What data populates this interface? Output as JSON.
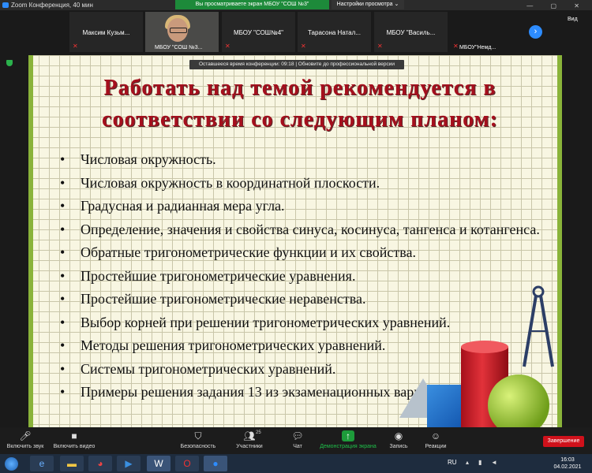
{
  "window": {
    "title": "Zoom Конференция, 40 мин",
    "controls": "— ▢ ✕"
  },
  "share_banner": "Вы просматриваете экран МБОУ \"СОШ №3\"",
  "view_options": "Настройки просмотра ⌄",
  "view_label": "Вид",
  "participants": [
    {
      "name": "Максим Кузьм...",
      "sub": ""
    },
    {
      "name": "",
      "sub": "МБОУ \"СОШ №3..."
    },
    {
      "name": "МБОУ \"СОШ№4\"",
      "sub": ""
    },
    {
      "name": "Тарасона Натал...",
      "sub": ""
    },
    {
      "name": "МБОУ \"Василь...",
      "sub": ""
    },
    {
      "name": "",
      "sub": "МБОУ\"Немд..."
    }
  ],
  "timer_banner": "Оставшееся время конференции: 09:18 | Обновите до профессиональной версии",
  "slide": {
    "title_line1": "Работать над темой рекомендуется в",
    "title_line2": "соответствии со следующим планом:",
    "bullet": "•",
    "items": [
      "Числовая окружность.",
      "Числовая окружность в координатной плоскости.",
      "Градусная и радианная мера угла.",
      "Определение, значения и свойства синуса, косинуса, тангенса и котангенса.",
      "Обратные тригонометрические функции и их свойства.",
      "Простейшие тригонометрические уравнения.",
      "Простейшие тригонометрические неравенства.",
      "Выбор корней при решении тригонометрических уравнений.",
      "Методы решения тригонометрических уравнений.",
      "Системы тригонометрических уравнений.",
      "Примеры решения задания 13 из экзаменационных вариантов."
    ]
  },
  "toolbar": {
    "mute": "Включить звук",
    "video": "Включить видео",
    "security": "Безопасность",
    "participants": "Участники",
    "participants_count": "25",
    "chat": "Чат",
    "share": "Демонстрация экрана",
    "record": "Запись",
    "reactions": "Реакции",
    "end": "Завершение"
  },
  "taskbar": {
    "lang": "RU",
    "time": "16:03",
    "date": "04.02.2021"
  },
  "colors": {
    "title_red": "#a50f1d",
    "zoom_blue": "#2d8cff",
    "end_red": "#d0111b",
    "share_green": "#1d9b3a"
  }
}
